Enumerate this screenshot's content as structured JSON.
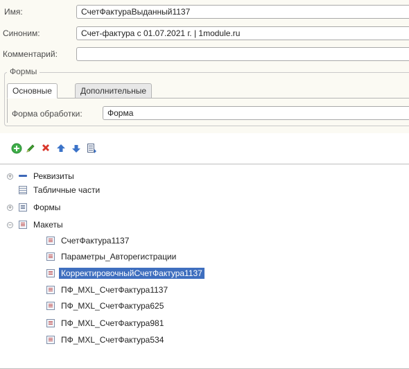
{
  "fields": {
    "name": {
      "label": "Имя:",
      "value": "СчетФактураВыданный1137"
    },
    "synonym": {
      "label": "Синоним:",
      "value": "Счет-фактура с 01.07.2021 г. | 1module.ru"
    },
    "comment": {
      "label": "Комментарий:",
      "value": ""
    }
  },
  "forms_group": {
    "title": "Формы",
    "tabs": [
      {
        "label": "Основные",
        "active": true
      },
      {
        "label": "Дополнительные",
        "active": false
      }
    ],
    "processing_form": {
      "label": "Форма обработки:",
      "value": "Форма"
    }
  },
  "toolbar": {
    "icons": [
      "add-icon",
      "edit-icon",
      "delete-icon",
      "move-up-icon",
      "move-down-icon",
      "sort-icon"
    ],
    "colors": {
      "add": "#3fae49",
      "edit": "#3f9e2f",
      "delete": "#d9362b",
      "arrows": "#3b73c8"
    }
  },
  "tree": {
    "items": [
      {
        "label": "Реквизиты",
        "expander": "+",
        "icon": "attribute-icon"
      },
      {
        "label": "Табличные части",
        "expander": "",
        "icon": "table-icon"
      },
      {
        "label": "Формы",
        "expander": "+",
        "icon": "form-icon"
      },
      {
        "label": "Макеты",
        "expander": "−",
        "icon": "layout-icon"
      }
    ],
    "templates": [
      {
        "label": "СчетФактура1137",
        "selected": false
      },
      {
        "label": "Параметры_Авторегистрации",
        "selected": false
      },
      {
        "label": "КорректировочныйСчетФактура1137",
        "selected": true
      },
      {
        "label": "ПФ_MXL_СчетФактура1137",
        "selected": false
      },
      {
        "label": "ПФ_MXL_СчетФактура625",
        "selected": false
      },
      {
        "label": "ПФ_MXL_СчетФактура981",
        "selected": false
      },
      {
        "label": "ПФ_MXL_СчетФактура534",
        "selected": false
      }
    ],
    "selection_color": "#3f6fbf"
  }
}
